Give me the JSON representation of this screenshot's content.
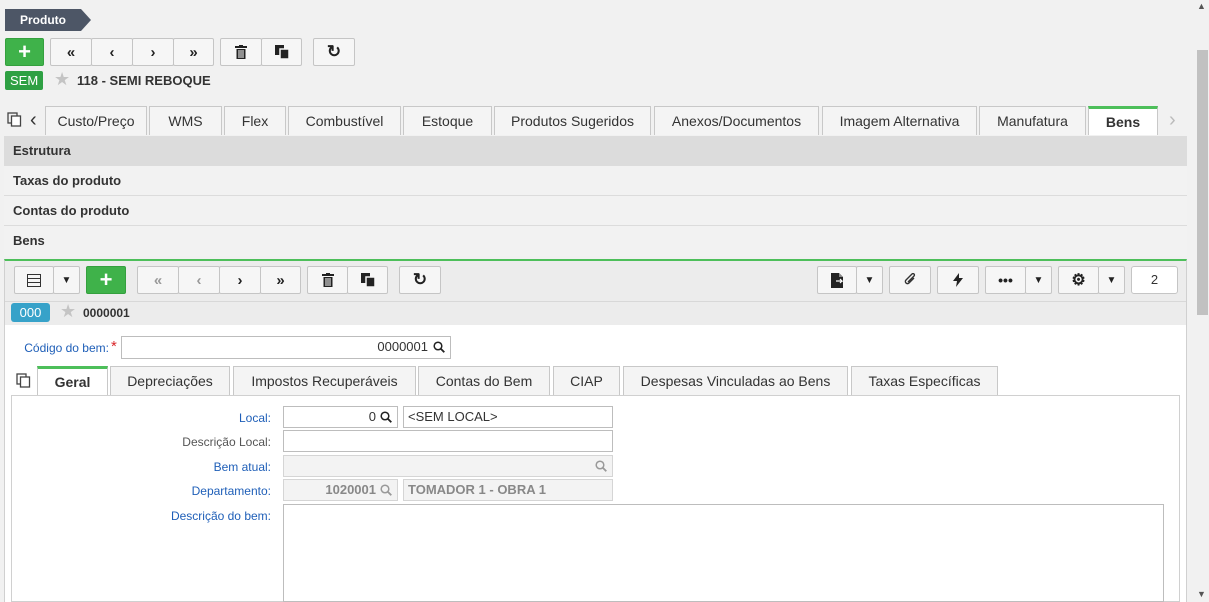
{
  "breadcrumb": "Produto",
  "record": {
    "badge": "SEM",
    "title": "118 - SEMI REBOQUE"
  },
  "tabs": [
    "Custo/Preço",
    "WMS",
    "Flex",
    "Combustível",
    "Estoque",
    "Produtos Sugeridos",
    "Anexos/Documentos",
    "Imagem Alternativa",
    "Manufatura",
    "Bens"
  ],
  "accordion": [
    "Estrutura",
    "Taxas do produto",
    "Contas do produto",
    "Bens"
  ],
  "subrecord": {
    "badge": "000",
    "code": "0000001",
    "page": "2"
  },
  "codigo": {
    "label": "Código do bem:",
    "required": "*",
    "value": "0000001"
  },
  "inner_tabs": [
    "Geral",
    "Depreciações",
    "Impostos Recuperáveis",
    "Contas do Bem",
    "CIAP",
    "Despesas Vinculadas ao Bens",
    "Taxas Específicas"
  ],
  "form": {
    "local_label": "Local:",
    "local_code": "0",
    "local_name": "<SEM LOCAL>",
    "desc_local_label": "Descrição Local:",
    "desc_local_value": "",
    "bem_atual_label": "Bem atual:",
    "bem_atual_value": "",
    "depto_label": "Departamento:",
    "depto_code": "1020001",
    "depto_name": "TOMADOR 1 - OBRA 1",
    "desc_bem_label": "Descrição do bem:",
    "desc_bem_value": ""
  },
  "colors": {
    "accent_green": "#3fb24a",
    "badge_blue": "#37a2c9",
    "crumb": "#4d5666"
  }
}
